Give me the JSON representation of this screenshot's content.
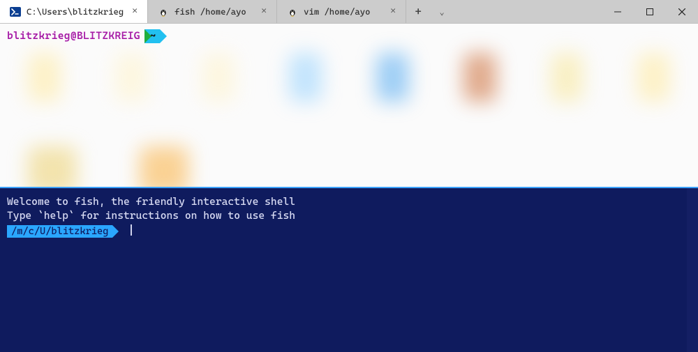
{
  "tabs": [
    {
      "title": "C:\\Users\\blitzkrieg",
      "icon": "powershell",
      "active": true
    },
    {
      "title": "fish /home/ayo",
      "icon": "tux",
      "active": false
    },
    {
      "title": "vim /home/ayo",
      "icon": "tux",
      "active": false
    }
  ],
  "window": {
    "newtab_glyph": "+",
    "dropdown_glyph": "⌄"
  },
  "top_pane": {
    "user_host": "blitzkrieg@BLITZKREIG",
    "cwd": "~"
  },
  "bottom_pane": {
    "line1": "Welcome to fish, the friendly interactive shell",
    "line2": "Type `help` for instructions on how to use fish",
    "prompt_path": "/m/c/U/blitzkrieg"
  }
}
